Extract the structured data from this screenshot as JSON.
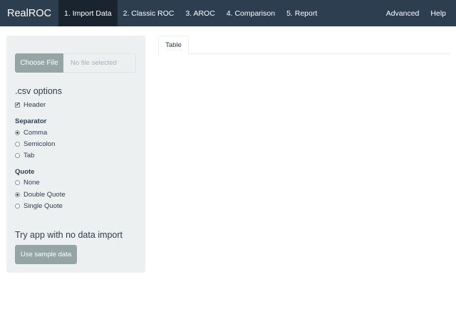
{
  "navbar": {
    "brand": "RealROC",
    "tabs": [
      {
        "label": "1. Import Data",
        "active": true
      },
      {
        "label": "2. Classic ROC",
        "active": false
      },
      {
        "label": "3. AROC",
        "active": false
      },
      {
        "label": "4. Comparison",
        "active": false
      },
      {
        "label": "5. Report",
        "active": false
      }
    ],
    "right": [
      {
        "label": "Advanced"
      },
      {
        "label": "Help"
      }
    ]
  },
  "sidebar": {
    "file_input": {
      "button_label": "Choose File",
      "placeholder": "No file selected"
    },
    "csv_options_title": ".csv options",
    "header_checkbox": {
      "label": "Header",
      "checked": true
    },
    "separator": {
      "label": "Separator",
      "options": [
        {
          "label": "Comma",
          "selected": true
        },
        {
          "label": "Semicolon",
          "selected": false
        },
        {
          "label": "Tab",
          "selected": false
        }
      ]
    },
    "quote": {
      "label": "Quote",
      "options": [
        {
          "label": "None",
          "selected": false
        },
        {
          "label": "Double Quote",
          "selected": true
        },
        {
          "label": "Single Quote",
          "selected": false
        }
      ]
    },
    "sample_title": "Try app with no data import",
    "sample_button": "Use sample data"
  },
  "main": {
    "tabs": [
      {
        "label": "Table",
        "active": true
      }
    ]
  },
  "colors": {
    "navbar": "#2c3e50",
    "navbar_active": "#1a242f",
    "sidebar_bg": "#ecf0f1",
    "button": "#95a5a6"
  }
}
